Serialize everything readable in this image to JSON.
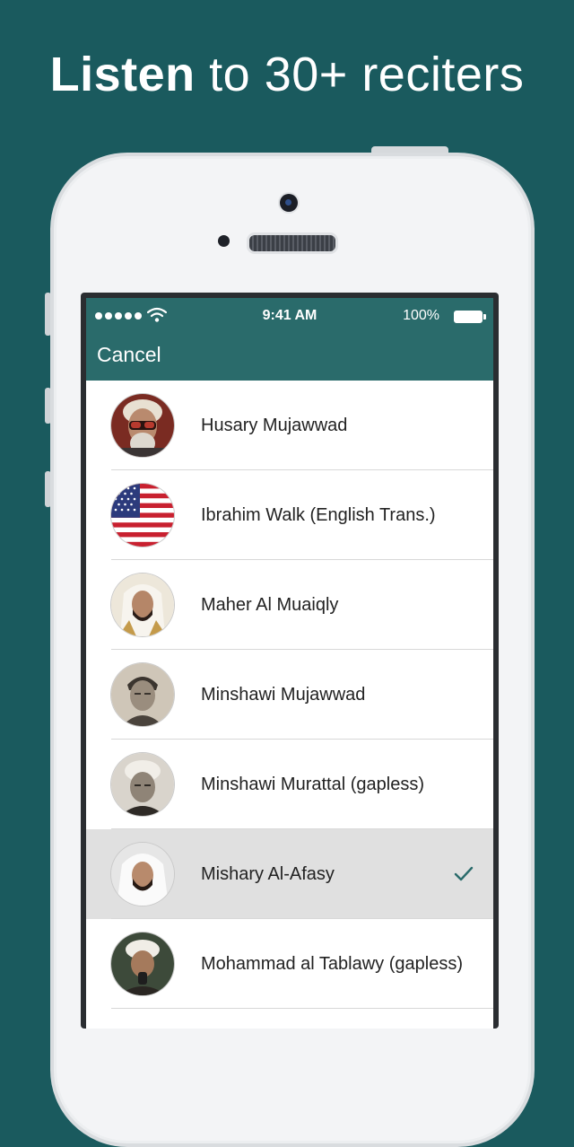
{
  "headline": {
    "strong": "Listen",
    "rest": " to 30+ reciters"
  },
  "status_bar": {
    "time": "9:41 AM",
    "battery": "100%"
  },
  "navbar": {
    "cancel_label": "Cancel"
  },
  "reciters": [
    {
      "name": "Husary Mujawwad",
      "avatar": "portrait-red-glasses"
    },
    {
      "name": "Ibrahim Walk (English Trans.)",
      "avatar": "us-flag"
    },
    {
      "name": "Maher Al Muaiqly",
      "avatar": "portrait-white-headdress"
    },
    {
      "name": "Minshawi Mujawwad",
      "avatar": "portrait-sepia"
    },
    {
      "name": "Minshawi Murattal (gapless)",
      "avatar": "portrait-sepia-turban"
    },
    {
      "name": "Mishary Al-Afasy",
      "avatar": "portrait-white-headdress",
      "selected": true
    },
    {
      "name": "Mohammad al Tablawy (gapless)",
      "avatar": "portrait-turban-microphone"
    }
  ],
  "colors": {
    "background": "#1a5a5e",
    "navbar": "#2a6b6b",
    "checkmark": "#2a6b6b"
  }
}
